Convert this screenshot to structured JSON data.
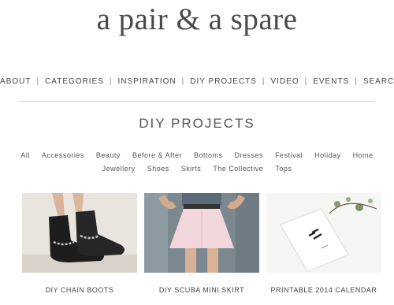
{
  "site": {
    "logo": "a pair & a spare"
  },
  "nav": {
    "items": [
      "ABOUT",
      "CATEGORIES",
      "INSPIRATION",
      "DIY PROJECTS",
      "VIDEO",
      "EVENTS",
      "SEARCH"
    ],
    "separator": "|"
  },
  "section": {
    "title": "DIY PROJECTS"
  },
  "filters": {
    "row1": [
      "All",
      "Accessories",
      "Beauty",
      "Before & After",
      "Bottoms",
      "Dresses",
      "Festival",
      "Holiday",
      "Home"
    ],
    "row2": [
      "Jewellery",
      "Shoes",
      "Skirts",
      "The Collective",
      "Tops"
    ]
  },
  "posts": [
    {
      "title": "DIY CHAIN BOOTS",
      "image": "chain-boots-photo"
    },
    {
      "title": "DIY SCUBA MINI SKIRT",
      "image": "scuba-skirt-photo"
    },
    {
      "title": "PRINTABLE 2014 CALENDAR",
      "image": "calendar-photo"
    }
  ]
}
